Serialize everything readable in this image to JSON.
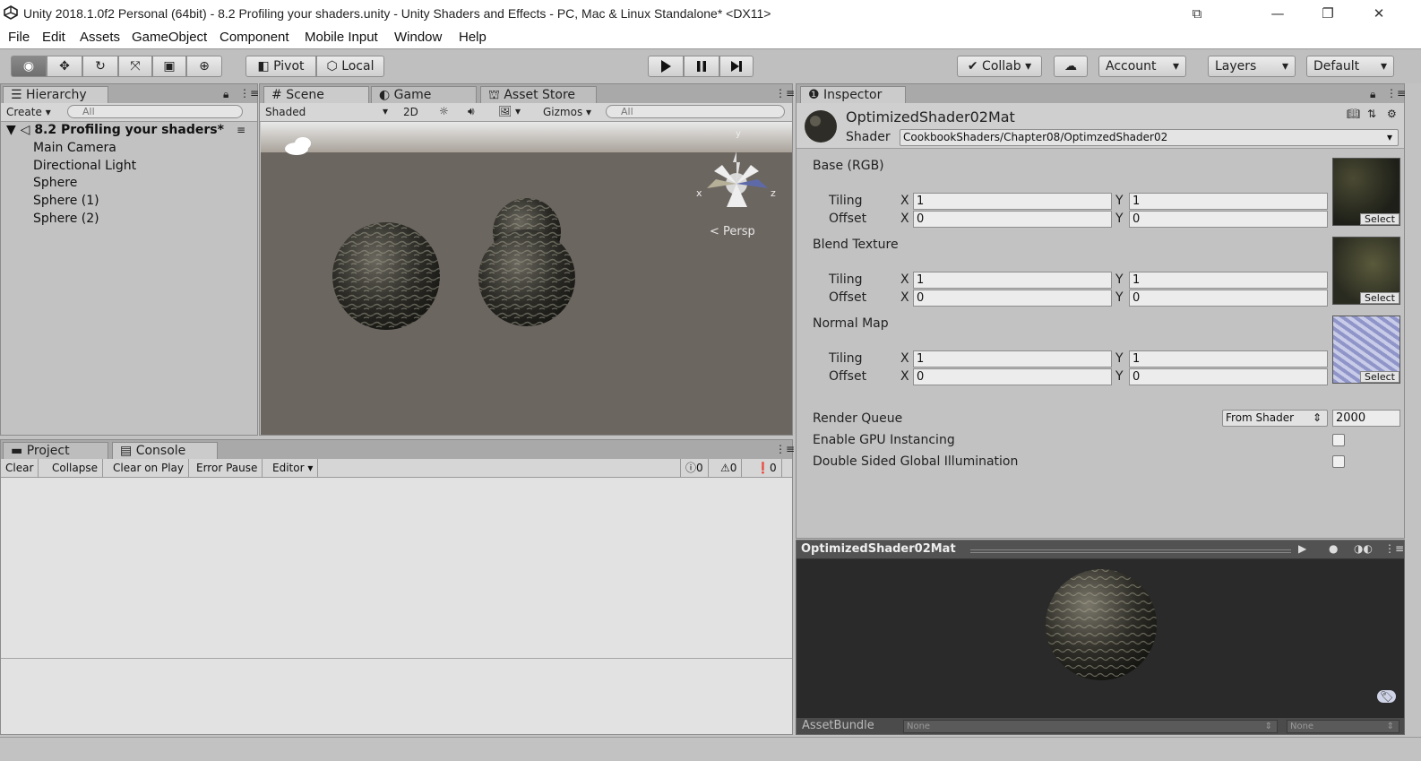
{
  "window": {
    "title": "Unity 2018.1.0f2 Personal (64bit) - 8.2 Profiling your shaders.unity - Unity Shaders and Effects - PC, Mac & Linux Standalone* <DX11>"
  },
  "menu": [
    "File",
    "Edit",
    "Assets",
    "GameObject",
    "Component",
    "Mobile Input",
    "Window",
    "Help"
  ],
  "toolbar": {
    "pivot": "Pivot",
    "local": "Local",
    "collab": "Collab",
    "account": "Account",
    "layers": "Layers",
    "layout": "Default"
  },
  "hierarchy": {
    "tab": "Hierarchy",
    "create": "Create",
    "search_placeholder": "All",
    "scene": "8.2 Profiling your shaders*",
    "items": [
      "Main Camera",
      "Directional Light",
      "Sphere",
      "Sphere (1)",
      "Sphere (2)"
    ]
  },
  "scene_view": {
    "tabs": [
      "Scene",
      "Game",
      "Asset Store"
    ],
    "shading": "Shaded",
    "mode_2d": "2D",
    "gizmos": "Gizmos",
    "search_placeholder": "All",
    "persp": "< Persp",
    "axis_x": "x",
    "axis_z": "z",
    "axis_y": "y"
  },
  "inspector": {
    "tab": "Inspector",
    "material_name": "OptimizedShader02Mat",
    "shader_label": "Shader",
    "shader_value": "CookbookShaders/Chapter08/OptimzedShader02",
    "properties": [
      {
        "name": "Base (RGB)",
        "tiling_x": "1",
        "tiling_y": "1",
        "offset_x": "0",
        "offset_y": "0",
        "select": "Select"
      },
      {
        "name": "Blend Texture",
        "tiling_x": "1",
        "tiling_y": "1",
        "offset_x": "0",
        "offset_y": "0",
        "select": "Select"
      },
      {
        "name": "Normal Map",
        "tiling_x": "1",
        "tiling_y": "1",
        "offset_x": "0",
        "offset_y": "0",
        "select": "Select"
      }
    ],
    "tiling_label": "Tiling",
    "offset_label": "Offset",
    "x_label": "X",
    "y_label": "Y",
    "render_queue_label": "Render Queue",
    "render_queue_mode": "From Shader",
    "render_queue_value": "2000",
    "gpu_instancing_label": "Enable GPU Instancing",
    "double_sided_label": "Double Sided Global Illumination",
    "preview_title": "OptimizedShader02Mat",
    "assetbundle_label": "AssetBundle",
    "assetbundle_value": "None",
    "assetbundle_variant": "None"
  },
  "console": {
    "tabs": [
      "Project",
      "Console"
    ],
    "buttons": [
      "Clear",
      "Collapse",
      "Clear on Play",
      "Error Pause",
      "Editor"
    ],
    "counts": {
      "info": "0",
      "warn": "0",
      "error": "0"
    }
  }
}
